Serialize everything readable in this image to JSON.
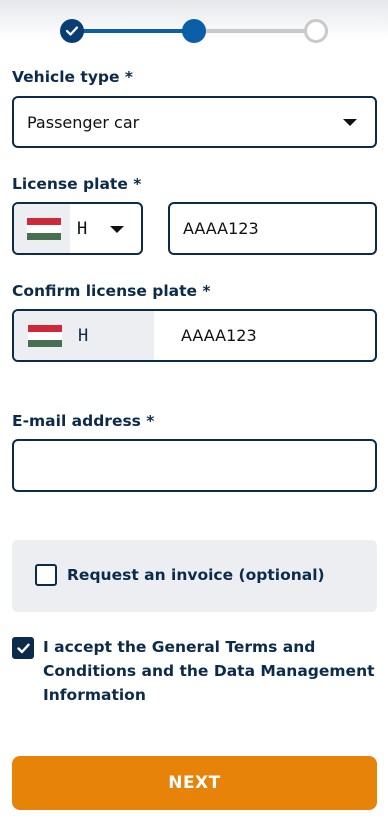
{
  "stepper": {
    "steps": [
      {
        "state": "completed",
        "icon": "check-icon"
      },
      {
        "state": "current"
      },
      {
        "state": "upcoming"
      }
    ],
    "colors": {
      "done": "#0a5fa8",
      "todo": "#c9c9c9",
      "completed_fill": "#0a3d74"
    }
  },
  "vehicle_type": {
    "label": "Vehicle type *",
    "value": "Passenger car",
    "icon": "chevron-down-icon"
  },
  "license_plate": {
    "label": "License plate *",
    "country_code": "H",
    "country_flag": "hungary-flag-icon",
    "value": "AAAA123"
  },
  "confirm_plate": {
    "label": "Confirm license plate *",
    "country_code": "H",
    "country_flag": "hungary-flag-icon",
    "value": "AAAA123"
  },
  "email": {
    "label": "E-mail address *",
    "value": ""
  },
  "invoice": {
    "label": "Request an invoice (optional)",
    "checked": false
  },
  "terms": {
    "label": "I accept the General Terms and Conditions and the Data Management Information",
    "checked": true
  },
  "next_button": {
    "label": "NEXT",
    "color": "#e8830a"
  }
}
